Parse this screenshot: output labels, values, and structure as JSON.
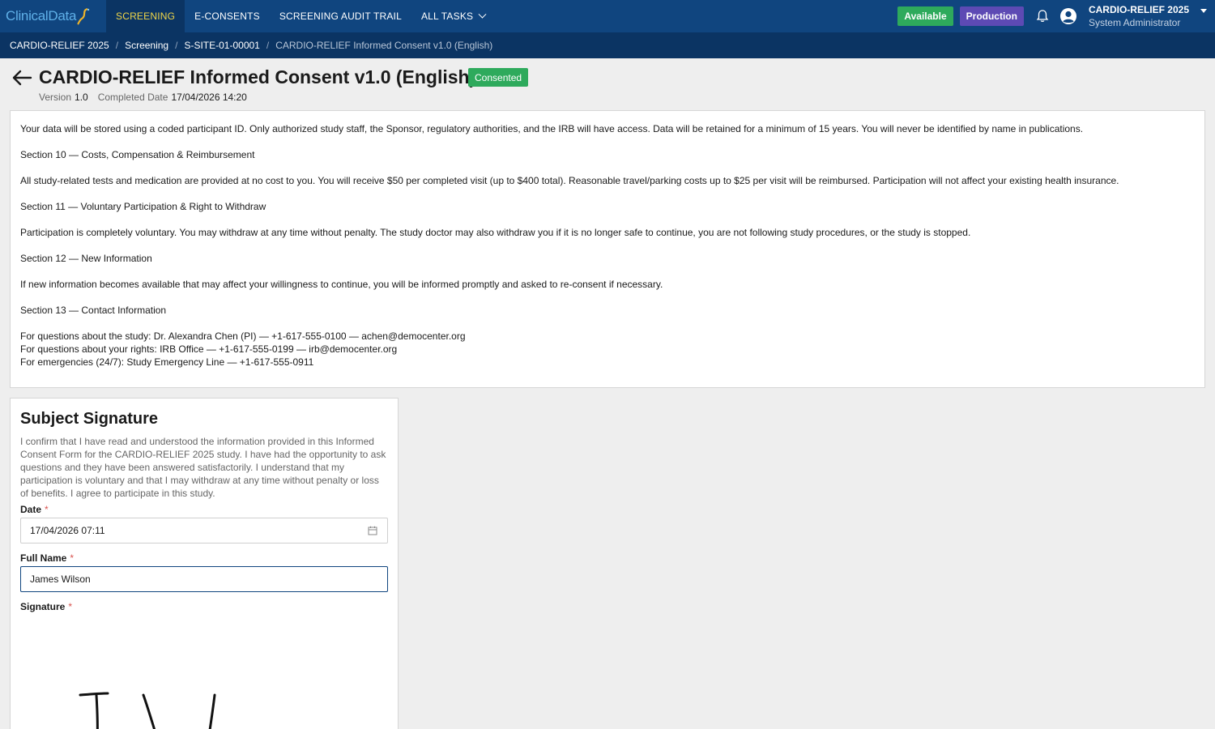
{
  "app": {
    "logo_text": "ClinicalData",
    "nav": [
      {
        "label": "SCREENING",
        "active": true
      },
      {
        "label": "E-CONSENTS",
        "active": false
      },
      {
        "label": "SCREENING AUDIT TRAIL",
        "active": false
      },
      {
        "label": "ALL TASKS",
        "active": false
      }
    ],
    "badges": {
      "available": "Available",
      "production": "Production"
    },
    "user": {
      "study": "CARDIO-RELIEF 2025",
      "role": "System Administrator"
    }
  },
  "breadcrumb": [
    "CARDIO-RELIEF 2025",
    "Screening",
    "S-SITE-01-00001",
    "CARDIO-RELIEF Informed Consent v1.0 (English)"
  ],
  "header": {
    "title": "CARDIO-RELIEF Informed Consent v1.0 (English)",
    "status": "Consented",
    "version_label": "Version",
    "version_value": "1.0",
    "completed_label": "Completed Date",
    "completed_value": "17/04/2026 14:20"
  },
  "consent": {
    "p1": "Your data will be stored using a coded participant ID. Only authorized study staff, the Sponsor, regulatory authorities, and the IRB will have access. Data will be retained for a minimum of 15 years. You will never be identified by name in publications.",
    "s10": "Section 10 — Costs, Compensation & Reimbursement",
    "p10": "All study-related tests and medication are provided at no cost to you. You will receive $50 per completed visit (up to $400 total). Reasonable travel/parking costs up to $25 per visit will be reimbursed. Participation will not affect your existing health insurance.",
    "s11": "Section 11 — Voluntary Participation & Right to Withdraw",
    "p11": "Participation is completely voluntary. You may withdraw at any time without penalty. The study doctor may also withdraw you if it is no longer safe to continue, you are not following study procedures, or the study is stopped.",
    "s12": "Section 12 — New Information",
    "p12": "If new information becomes available that may affect your willingness to continue, you will be informed promptly and asked to re-consent if necessary.",
    "s13": "Section 13 — Contact Information",
    "contacts": [
      "For questions about the study: Dr. Alexandra Chen (PI) — +1-617-555-0100 — achen@democenter.org",
      "For questions about your rights: IRB Office — +1-617-555-0199 — irb@democenter.org",
      "For emergencies (24/7): Study Emergency Line — +1-617-555-0911"
    ]
  },
  "signature": {
    "title": "Subject Signature",
    "description": "I confirm that I have read and understood the information provided in this Informed Consent Form for the CARDIO-RELIEF 2025 study. I have had the opportunity to ask questions and they have been answered satisfactorily. I understand that my participation is voluntary and that I may withdraw at any time without penalty or loss of benefits. I agree to participate in this study.",
    "date_label": "Date",
    "date_value": "17/04/2026 07:11",
    "name_label": "Full Name",
    "name_value": "James Wilson",
    "signature_label": "Signature",
    "required_mark": "*",
    "signature_strokes": "JW"
  },
  "colors": {
    "nav_bg": "#10457f",
    "crumb_bg": "#0b3463",
    "active_nav_text": "#f0d648",
    "success": "#2eaa5c",
    "production": "#5d4ab4"
  }
}
